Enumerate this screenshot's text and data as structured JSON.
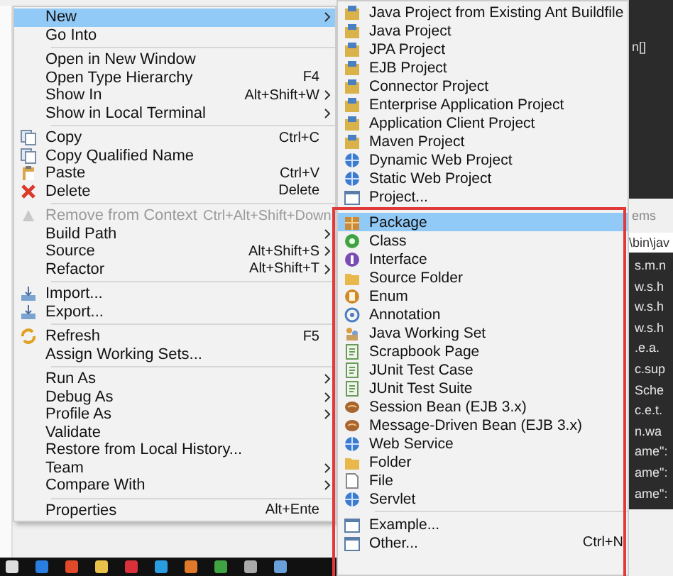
{
  "context_menu": {
    "groups": [
      [
        {
          "label": "New",
          "kind": "plain",
          "submenu": true,
          "selected": true,
          "disabled": false
        },
        {
          "label": "Go Into",
          "kind": "plain",
          "submenu": false,
          "selected": false,
          "disabled": false
        }
      ],
      [
        {
          "label": "Open in New Window",
          "kind": "plain",
          "submenu": false,
          "selected": false,
          "disabled": false
        },
        {
          "label": "Open Type Hierarchy",
          "shortcut": "F4",
          "kind": "plain",
          "submenu": false,
          "selected": false,
          "disabled": false
        },
        {
          "label": "Show In",
          "shortcut": "Alt+Shift+W",
          "kind": "plain",
          "submenu": true,
          "selected": false,
          "disabled": false
        },
        {
          "label": "Show in Local Terminal",
          "kind": "plain",
          "submenu": true,
          "selected": false,
          "disabled": false
        }
      ],
      [
        {
          "label": "Copy",
          "shortcut": "Ctrl+C",
          "kind": "copy",
          "submenu": false,
          "selected": false,
          "disabled": false
        },
        {
          "label": "Copy Qualified Name",
          "kind": "copy",
          "submenu": false,
          "selected": false,
          "disabled": false
        },
        {
          "label": "Paste",
          "shortcut": "Ctrl+V",
          "kind": "paste",
          "submenu": false,
          "selected": false,
          "disabled": false
        },
        {
          "label": "Delete",
          "shortcut": "Delete",
          "kind": "delete",
          "submenu": false,
          "selected": false,
          "disabled": false
        }
      ],
      [
        {
          "label": "Remove from Context",
          "shortcut": "Ctrl+Alt+Shift+Down",
          "kind": "remove",
          "submenu": false,
          "selected": false,
          "disabled": true
        },
        {
          "label": "Build Path",
          "kind": "plain",
          "submenu": true,
          "selected": false,
          "disabled": false
        },
        {
          "label": "Source",
          "shortcut": "Alt+Shift+S",
          "kind": "plain",
          "submenu": true,
          "selected": false,
          "disabled": false
        },
        {
          "label": "Refactor",
          "shortcut": "Alt+Shift+T",
          "kind": "plain",
          "submenu": true,
          "selected": false,
          "disabled": false
        }
      ],
      [
        {
          "label": "Import...",
          "kind": "tray",
          "submenu": false,
          "selected": false,
          "disabled": false
        },
        {
          "label": "Export...",
          "kind": "tray",
          "submenu": false,
          "selected": false,
          "disabled": false
        }
      ],
      [
        {
          "label": "Refresh",
          "shortcut": "F5",
          "kind": "refresh",
          "submenu": false,
          "selected": false,
          "disabled": false
        },
        {
          "label": "Assign Working Sets...",
          "kind": "plain",
          "submenu": false,
          "selected": false,
          "disabled": false
        }
      ],
      [
        {
          "label": "Run As",
          "kind": "plain",
          "submenu": true,
          "selected": false,
          "disabled": false
        },
        {
          "label": "Debug As",
          "kind": "plain",
          "submenu": true,
          "selected": false,
          "disabled": false
        },
        {
          "label": "Profile As",
          "kind": "plain",
          "submenu": true,
          "selected": false,
          "disabled": false
        },
        {
          "label": "Validate",
          "kind": "plain",
          "submenu": false,
          "selected": false,
          "disabled": false
        },
        {
          "label": "Restore from Local History...",
          "kind": "plain",
          "submenu": false,
          "selected": false,
          "disabled": false
        },
        {
          "label": "Team",
          "kind": "plain",
          "submenu": true,
          "selected": false,
          "disabled": false
        },
        {
          "label": "Compare With",
          "kind": "plain",
          "submenu": true,
          "selected": false,
          "disabled": false
        }
      ],
      [
        {
          "label": "Properties",
          "shortcut": "Alt+Ente",
          "kind": "plain",
          "submenu": false,
          "selected": false,
          "disabled": false
        }
      ]
    ]
  },
  "new_submenu": {
    "groups": [
      [
        {
          "label": "Java Project from Existing Ant Buildfile",
          "kind": "project",
          "selected": false
        },
        {
          "label": "Java Project",
          "kind": "project",
          "selected": false
        },
        {
          "label": "JPA Project",
          "kind": "project",
          "selected": false
        },
        {
          "label": "EJB Project",
          "kind": "project",
          "selected": false
        },
        {
          "label": "Connector Project",
          "kind": "project",
          "selected": false
        },
        {
          "label": "Enterprise Application Project",
          "kind": "project",
          "selected": false
        },
        {
          "label": "Application Client Project",
          "kind": "project",
          "selected": false
        },
        {
          "label": "Maven Project",
          "kind": "project",
          "selected": false
        },
        {
          "label": "Dynamic Web Project",
          "kind": "globe",
          "selected": false
        },
        {
          "label": "Static Web Project",
          "kind": "globe",
          "selected": false
        },
        {
          "label": "Project...",
          "kind": "window",
          "selected": false
        }
      ],
      [
        {
          "label": "Package",
          "kind": "package",
          "selected": true
        },
        {
          "label": "Class",
          "kind": "class",
          "selected": false
        },
        {
          "label": "Interface",
          "kind": "interface",
          "selected": false
        },
        {
          "label": "Source Folder",
          "kind": "folder",
          "selected": false
        },
        {
          "label": "Enum",
          "kind": "enum",
          "selected": false
        },
        {
          "label": "Annotation",
          "kind": "annotation",
          "selected": false
        },
        {
          "label": "Java Working Set",
          "kind": "people",
          "selected": false
        },
        {
          "label": "Scrapbook Page",
          "kind": "document",
          "selected": false
        },
        {
          "label": "JUnit Test Case",
          "kind": "document",
          "selected": false
        },
        {
          "label": "JUnit Test Suite",
          "kind": "document",
          "selected": false
        },
        {
          "label": "Session Bean (EJB 3.x)",
          "kind": "bean",
          "selected": false
        },
        {
          "label": "Message-Driven Bean (EJB 3.x)",
          "kind": "bean",
          "selected": false
        },
        {
          "label": "Web Service",
          "kind": "globe",
          "selected": false
        },
        {
          "label": "Folder",
          "kind": "folder",
          "selected": false
        },
        {
          "label": "File",
          "kind": "file",
          "selected": false
        },
        {
          "label": "Servlet",
          "kind": "globe",
          "selected": false
        }
      ],
      [
        {
          "label": "Example...",
          "kind": "window",
          "selected": false
        },
        {
          "label": "Other...",
          "shortcut": "Ctrl+N",
          "kind": "window",
          "selected": false
        }
      ]
    ]
  },
  "editor": {
    "top_text": "n[]",
    "tab_label": "ems",
    "path": "\\bin\\jav",
    "code_lines": [
      "s.m.n",
      "w.s.h",
      "w.s.h",
      "w.s.h",
      ".e.a.",
      "c.sup",
      "Sche",
      "c.e.t.",
      "n.wa",
      "ame\":",
      "ame\":",
      "ame\":"
    ]
  }
}
